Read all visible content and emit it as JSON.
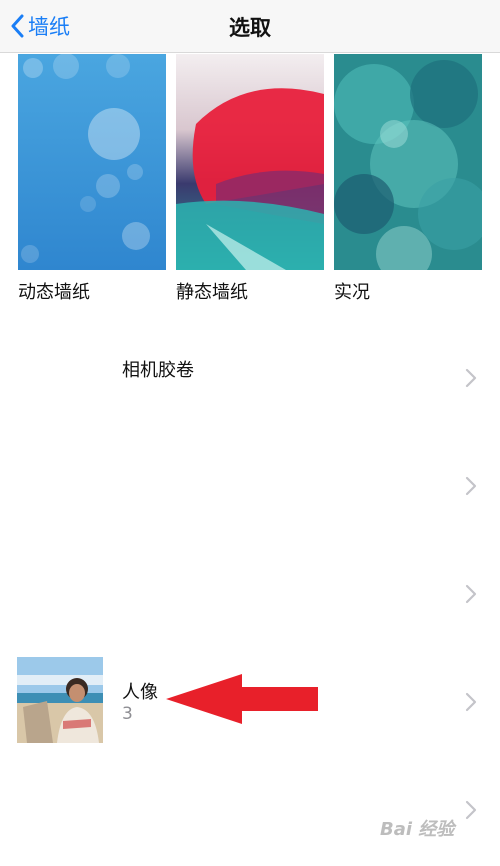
{
  "nav": {
    "back_label": "墙纸",
    "title": "选取"
  },
  "wallpaper_categories": [
    {
      "label": "动态墙纸"
    },
    {
      "label": "静态墙纸"
    },
    {
      "label": "实况"
    }
  ],
  "albums": [
    {
      "title": "相机胶卷",
      "count": ""
    },
    {
      "title": "",
      "count": ""
    },
    {
      "title": "",
      "count": ""
    },
    {
      "title": "人像",
      "count": "3"
    },
    {
      "title": "",
      "count": ""
    }
  ],
  "watermark": "Bai 经验",
  "colors": {
    "accent": "#1a7ef6",
    "annotation_arrow": "#e8202a"
  }
}
